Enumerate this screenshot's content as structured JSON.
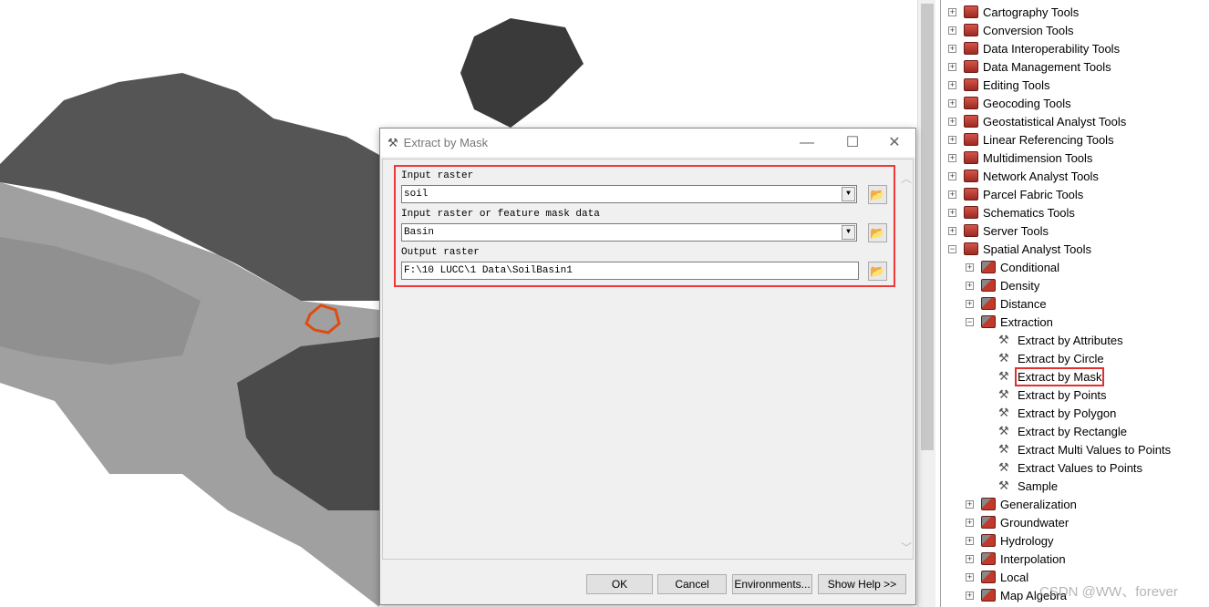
{
  "dialog": {
    "title": "Extract by Mask",
    "minimize": "—",
    "maximize": "☐",
    "close": "✕",
    "fields": [
      {
        "label": "Input raster",
        "value": "soil",
        "type": "dropdown"
      },
      {
        "label": "Input raster or feature mask data",
        "value": "Basin",
        "type": "dropdown"
      },
      {
        "label": "Output raster",
        "value": "F:\\10 LUCC\\1 Data\\SoilBasin1",
        "type": "text"
      }
    ],
    "buttons": {
      "ok": "OK",
      "cancel": "Cancel",
      "environments": "Environments...",
      "help": "Show Help >>"
    }
  },
  "tree": {
    "items": [
      {
        "label": "Cartography Tools",
        "level": 0,
        "exp": "+"
      },
      {
        "label": "Conversion Tools",
        "level": 0,
        "exp": "+"
      },
      {
        "label": "Data Interoperability Tools",
        "level": 0,
        "exp": "+"
      },
      {
        "label": "Data Management Tools",
        "level": 0,
        "exp": "+"
      },
      {
        "label": "Editing Tools",
        "level": 0,
        "exp": "+"
      },
      {
        "label": "Geocoding Tools",
        "level": 0,
        "exp": "+"
      },
      {
        "label": "Geostatistical Analyst Tools",
        "level": 0,
        "exp": "+"
      },
      {
        "label": "Linear Referencing Tools",
        "level": 0,
        "exp": "+"
      },
      {
        "label": "Multidimension Tools",
        "level": 0,
        "exp": "+"
      },
      {
        "label": "Network Analyst Tools",
        "level": 0,
        "exp": "+"
      },
      {
        "label": "Parcel Fabric Tools",
        "level": 0,
        "exp": "+"
      },
      {
        "label": "Schematics Tools",
        "level": 0,
        "exp": "+"
      },
      {
        "label": "Server Tools",
        "level": 0,
        "exp": "+"
      },
      {
        "label": "Spatial Analyst Tools",
        "level": 0,
        "exp": "−"
      },
      {
        "label": "Conditional",
        "level": 1,
        "exp": "+"
      },
      {
        "label": "Density",
        "level": 1,
        "exp": "+"
      },
      {
        "label": "Distance",
        "level": 1,
        "exp": "+"
      },
      {
        "label": "Extraction",
        "level": 1,
        "exp": "−"
      },
      {
        "label": "Extract by Attributes",
        "level": 2
      },
      {
        "label": "Extract by Circle",
        "level": 2
      },
      {
        "label": "Extract by Mask",
        "level": 2,
        "selected": true
      },
      {
        "label": "Extract by Points",
        "level": 2
      },
      {
        "label": "Extract by Polygon",
        "level": 2
      },
      {
        "label": "Extract by Rectangle",
        "level": 2
      },
      {
        "label": "Extract Multi Values to Points",
        "level": 2
      },
      {
        "label": "Extract Values to Points",
        "level": 2
      },
      {
        "label": "Sample",
        "level": 2
      },
      {
        "label": "Generalization",
        "level": 1,
        "exp": "+"
      },
      {
        "label": "Groundwater",
        "level": 1,
        "exp": "+"
      },
      {
        "label": "Hydrology",
        "level": 1,
        "exp": "+"
      },
      {
        "label": "Interpolation",
        "level": 1,
        "exp": "+"
      },
      {
        "label": "Local",
        "level": 1,
        "exp": "+"
      },
      {
        "label": "Map Algebra",
        "level": 1,
        "exp": "+"
      }
    ]
  },
  "watermark": "CSDN @WW、forever",
  "colors": {
    "highlight": "#f03838",
    "basin": "#e04a10"
  }
}
